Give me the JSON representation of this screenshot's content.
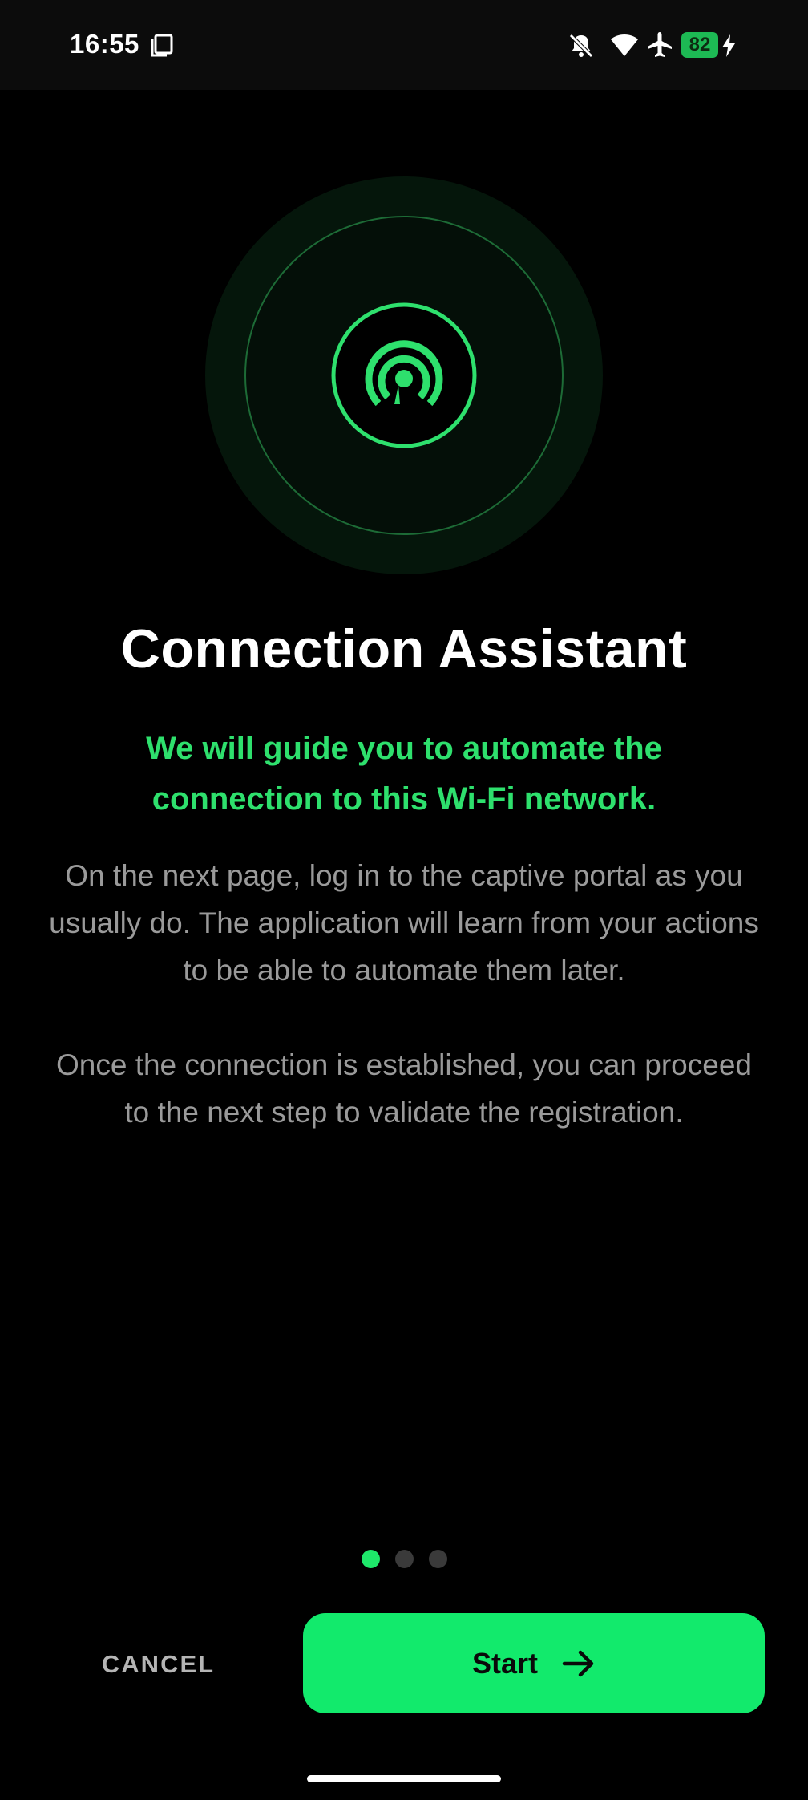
{
  "status_bar": {
    "time": "16:55",
    "battery": "82",
    "icons": [
      "screenshot-icon",
      "mute-icon",
      "wifi-icon",
      "airplane-icon",
      "battery-icon",
      "charging-icon"
    ]
  },
  "hero": {
    "icon": "wifi-hotspot-icon",
    "accent_color": "#2ee06d"
  },
  "title": "Connection Assistant",
  "subtitle": "We will guide you to automate the connection to this Wi-Fi network.",
  "body": {
    "paragraph_1": "On the next page, log in to the captive portal as you usually do. The application will learn from your actions to be able to automate them later.",
    "paragraph_2": "Once the connection is established, you can proceed to the next step to validate the registration."
  },
  "pager": {
    "total": 3,
    "current": 1
  },
  "actions": {
    "cancel_label": "CANCEL",
    "start_label": "Start",
    "start_icon": "arrow-right-icon",
    "start_color": "#12ea6c"
  }
}
